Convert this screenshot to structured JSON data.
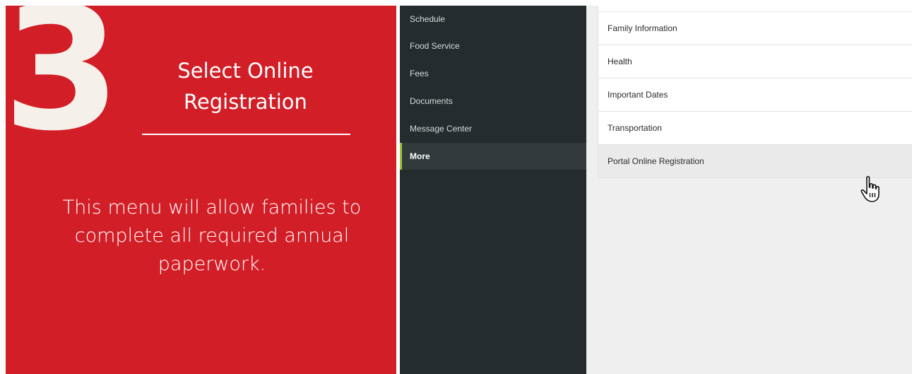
{
  "info": {
    "step_number": "3",
    "title_line1": "Select Online",
    "title_line2": "Registration",
    "description": "This menu will allow families to complete all required annual paperwork.",
    "background_color": "#d21e27"
  },
  "sidebar": {
    "items": [
      {
        "label": "Schedule"
      },
      {
        "label": "Food Service"
      },
      {
        "label": "Fees"
      },
      {
        "label": "Documents"
      },
      {
        "label": "Message Center"
      },
      {
        "label": "More",
        "active": true
      }
    ],
    "accent_color": "#9bc23c"
  },
  "menu": {
    "items": [
      {
        "label": "Family Information"
      },
      {
        "label": "Health"
      },
      {
        "label": "Important Dates"
      },
      {
        "label": "Transportation"
      },
      {
        "label": "Portal Online Registration",
        "hovered": true
      }
    ]
  },
  "icons": {
    "cursor": "hand-pointer-icon"
  }
}
